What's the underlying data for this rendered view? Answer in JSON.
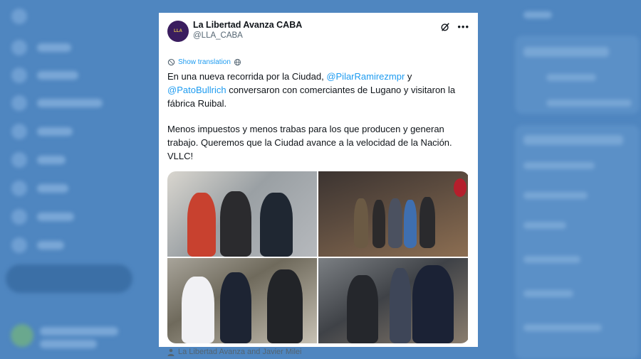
{
  "author": {
    "name": "La Libertad Avanza CABA",
    "handle": "@LLA_CABA"
  },
  "translate_label": "Show translation",
  "tweet": {
    "line1_before": "En una nueva recorrida por la Ciudad, ",
    "mention1": "@PilarRamirezmpr",
    "line1_after": " y",
    "mention2": "@PatoBullrich",
    "line2_after": " conversaron con comerciantes de Lugano y visitaron la fábrica Ruibal.",
    "paragraph2": "Menos impuestos y menos trabas para los que producen y generan trabajo. Queremos que la Ciudad avance a la velocidad de la Nación. VLLC!"
  },
  "media_caption": "La Libertad Avanza and Javier Milei",
  "colors": {
    "background": "#4f86c0",
    "link": "#1d9bf0",
    "text": "#0f1419",
    "muted": "#536471"
  },
  "icons": {
    "grok": "grok-icon",
    "more": "more-icon",
    "translate": "globe-icon",
    "tagged": "person-icon"
  }
}
